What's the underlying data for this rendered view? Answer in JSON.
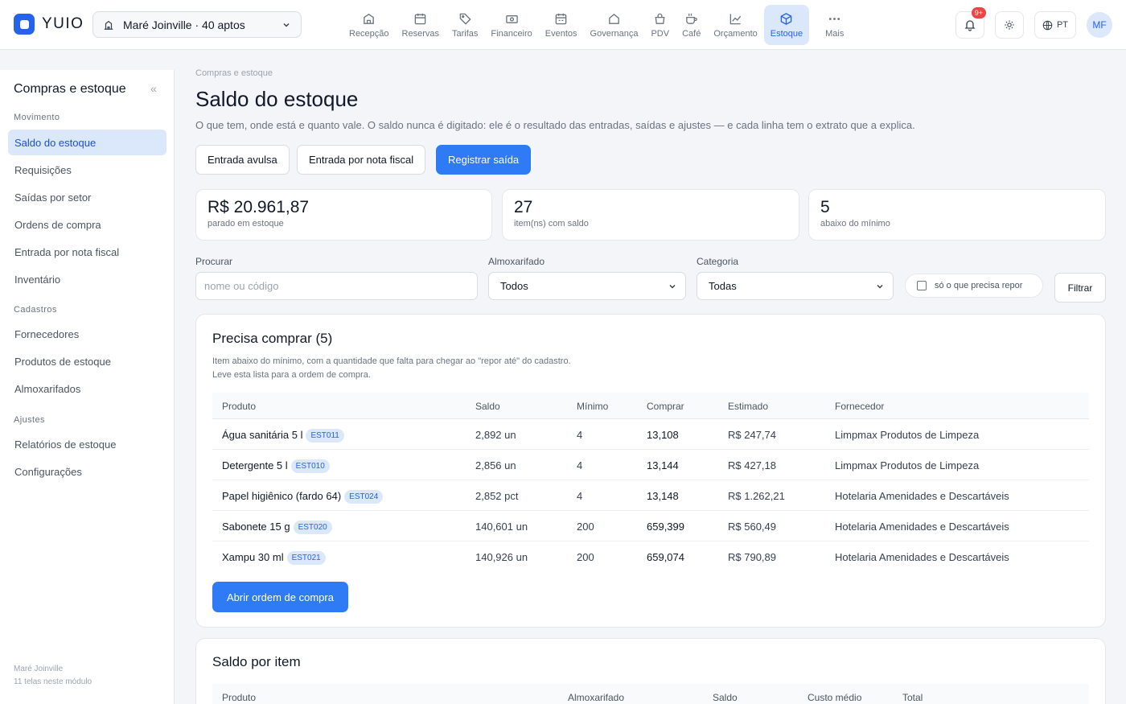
{
  "header": {
    "logo_text": "YUIO",
    "property": "Maré Joinville · 40 aptos",
    "nav": [
      {
        "label": "Recepção",
        "icon": "reception-icon"
      },
      {
        "label": "Reservas",
        "icon": "calendar-icon"
      },
      {
        "label": "Tarifas",
        "icon": "tag-icon"
      },
      {
        "label": "Financeiro",
        "icon": "cash-icon"
      },
      {
        "label": "Eventos",
        "icon": "event-calendar-icon"
      },
      {
        "label": "Governança",
        "icon": "house-icon"
      },
      {
        "label": "PDV",
        "icon": "pos-bag-icon"
      },
      {
        "label": "Café",
        "icon": "coffee-icon"
      },
      {
        "label": "Orçamento",
        "icon": "chart-line-icon"
      },
      {
        "label": "Estoque",
        "icon": "box-icon"
      },
      {
        "label": "Mais",
        "icon": "more-dots-icon"
      }
    ],
    "active_nav": "Estoque",
    "notifications_badge": "9+",
    "language": "PT",
    "user_initials": "MF"
  },
  "sidebar": {
    "title": "Compras e estoque",
    "sections": [
      {
        "label": "Movimento",
        "items": [
          "Saldo do estoque",
          "Requisições",
          "Saídas por setor",
          "Ordens de compra",
          "Entrada por nota fiscal",
          "Inventário"
        ]
      },
      {
        "label": "Cadastros",
        "items": [
          "Fornecedores",
          "Produtos de estoque",
          "Almoxarifados"
        ]
      },
      {
        "label": "Ajustes",
        "items": [
          "Relatórios de estoque",
          "Configurações"
        ]
      }
    ],
    "active_item": "Saldo do estoque",
    "footer_property": "Maré Joinville",
    "footer_count": "11 telas neste módulo"
  },
  "page": {
    "breadcrumb": "Compras e estoque",
    "title": "Saldo do estoque",
    "description": "O que tem, onde está e quanto vale. O saldo nunca é digitado: ele é o resultado das entradas, saídas e ajustes — e cada linha tem o extrato que a explica.",
    "actions": {
      "entrada_avulsa": "Entrada avulsa",
      "entrada_nf": "Entrada por nota fiscal",
      "registrar_saida": "Registrar saída"
    }
  },
  "stats": [
    {
      "value": "R$ 20.961,87",
      "label": "parado em estoque"
    },
    {
      "value": "27",
      "label": "item(ns) com saldo"
    },
    {
      "value": "5",
      "label": "abaixo do mínimo"
    }
  ],
  "filters": {
    "search_label": "Procurar",
    "search_placeholder": "nome ou código",
    "warehouse_label": "Almoxarifado",
    "warehouse_value": "Todos",
    "category_label": "Categoria",
    "category_value": "Todas",
    "restock_only": "só o que precisa repor",
    "filter_button": "Filtrar"
  },
  "purchase_needed": {
    "title": "Precisa comprar (5)",
    "desc_line1": "Item abaixo do mínimo, com a quantidade que falta para chegar ao \"repor até\" do cadastro.",
    "desc_line2": "Leve esta lista para a ordem de compra.",
    "columns": [
      "Produto",
      "Saldo",
      "Mínimo",
      "Comprar",
      "Estimado",
      "Fornecedor"
    ],
    "rows": [
      {
        "product": "Água sanitária 5 l",
        "code": "EST011",
        "balance": "2,892 un",
        "minimum": "4",
        "buy": "13,108",
        "estimated": "R$ 247,74",
        "supplier": "Limpmax Produtos de Limpeza"
      },
      {
        "product": "Detergente 5 l",
        "code": "EST010",
        "balance": "2,856 un",
        "minimum": "4",
        "buy": "13,144",
        "estimated": "R$ 427,18",
        "supplier": "Limpmax Produtos de Limpeza"
      },
      {
        "product": "Papel higiênico (fardo 64)",
        "code": "EST024",
        "balance": "2,852 pct",
        "minimum": "4",
        "buy": "13,148",
        "estimated": "R$ 1.262,21",
        "supplier": "Hotelaria Amenidades e Descartáveis"
      },
      {
        "product": "Sabonete 15 g",
        "code": "EST020",
        "balance": "140,601 un",
        "minimum": "200",
        "buy": "659,399",
        "estimated": "R$ 560,49",
        "supplier": "Hotelaria Amenidades e Descartáveis"
      },
      {
        "product": "Xampu 30 ml",
        "code": "EST021",
        "balance": "140,926 un",
        "minimum": "200",
        "buy": "659,074",
        "estimated": "R$ 790,89",
        "supplier": "Hotelaria Amenidades e Descartáveis"
      }
    ],
    "open_order_button": "Abrir ordem de compra"
  },
  "balance_by_item": {
    "title": "Saldo por item",
    "columns": [
      "Produto",
      "Almoxarifado",
      "Saldo",
      "Custo médio",
      "Total"
    ]
  },
  "colors": {
    "accent": "#2f7bf5",
    "active_bg": "#dbe8fb",
    "alert": "#ef4444"
  }
}
